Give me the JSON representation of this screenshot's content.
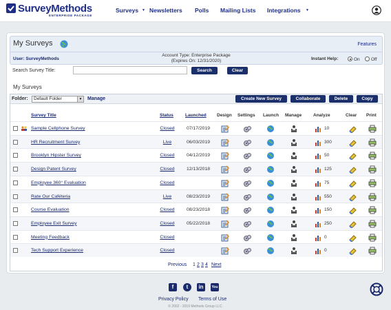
{
  "header": {
    "brand": "SurveyMethods",
    "brand_sub": "ENTERPRISE PACKAGE",
    "nav": [
      "Surveys",
      "Newsletters",
      "Polls",
      "Mailing Lists",
      "Integrations"
    ]
  },
  "panel": {
    "title": "My Surveys",
    "features": "Features",
    "user": "User: SurveyMethods",
    "account_type": "Account Type: Enterprise Package",
    "expires": "(Expires On: 12/31/2020)",
    "instant_help": "Instant Help:",
    "on": "On",
    "off": "Off",
    "instant_help_selected": "On"
  },
  "search": {
    "label": "Search Survey Title:",
    "value": "",
    "search_btn": "Search",
    "clear_btn": "Clear"
  },
  "list": {
    "section_title": "My Surveys",
    "folder_label": "Folder:",
    "folder_value": "Default Folder",
    "manage": "Manage",
    "buttons": {
      "create": "Create New Survey",
      "collaborate": "Collaborate",
      "delete": "Delete",
      "copy": "Copy"
    },
    "columns": {
      "title": "Survey Title",
      "status": "Status",
      "launched": "Launched",
      "design": "Design",
      "settings": "Settings",
      "launch": "Launch",
      "manage": "Manage",
      "analyze": "Analyze",
      "clear": "Clear",
      "print": "Print"
    },
    "rows": [
      {
        "title": "Sample Cellphone Survey",
        "status": "Closed",
        "launched": "07/17/2019",
        "responses": "10"
      },
      {
        "title": "HR Recruitment Survey",
        "status": "Live",
        "launched": "06/03/2019",
        "responses": "300"
      },
      {
        "title": "Brooklyn Hipster Survey",
        "status": "Closed",
        "launched": "04/12/2019",
        "responses": "50"
      },
      {
        "title": "Design Patent Survey",
        "status": "Closed",
        "launched": "12/13/2018",
        "responses": "125"
      },
      {
        "title": "Employee 360° Evaluation",
        "status": "Closed",
        "launched": "",
        "responses": "75"
      },
      {
        "title": "Rate Our Caféteria",
        "status": "Live",
        "launched": "08/23/2019",
        "responses": "550"
      },
      {
        "title": "Course Evaluation",
        "status": "Closed",
        "launched": "08/23/2018",
        "responses": "150"
      },
      {
        "title": "Employee Exit Survey",
        "status": "Closed",
        "launched": "05/22/2018",
        "responses": "250"
      },
      {
        "title": "Meeting Feedback",
        "status": "Closed",
        "launched": "",
        "responses": "0"
      },
      {
        "title": "Tech Support Experience",
        "status": "Closed",
        "launched": "",
        "responses": "0"
      }
    ],
    "pager": {
      "previous": "Previous",
      "current": "1",
      "pages": [
        "2",
        "3",
        "4"
      ],
      "next": "Next"
    }
  },
  "footer": {
    "privacy": "Privacy Policy",
    "terms": "Terms of Use",
    "copyright": "© 2002 - 2019 Methods Group LLC."
  }
}
